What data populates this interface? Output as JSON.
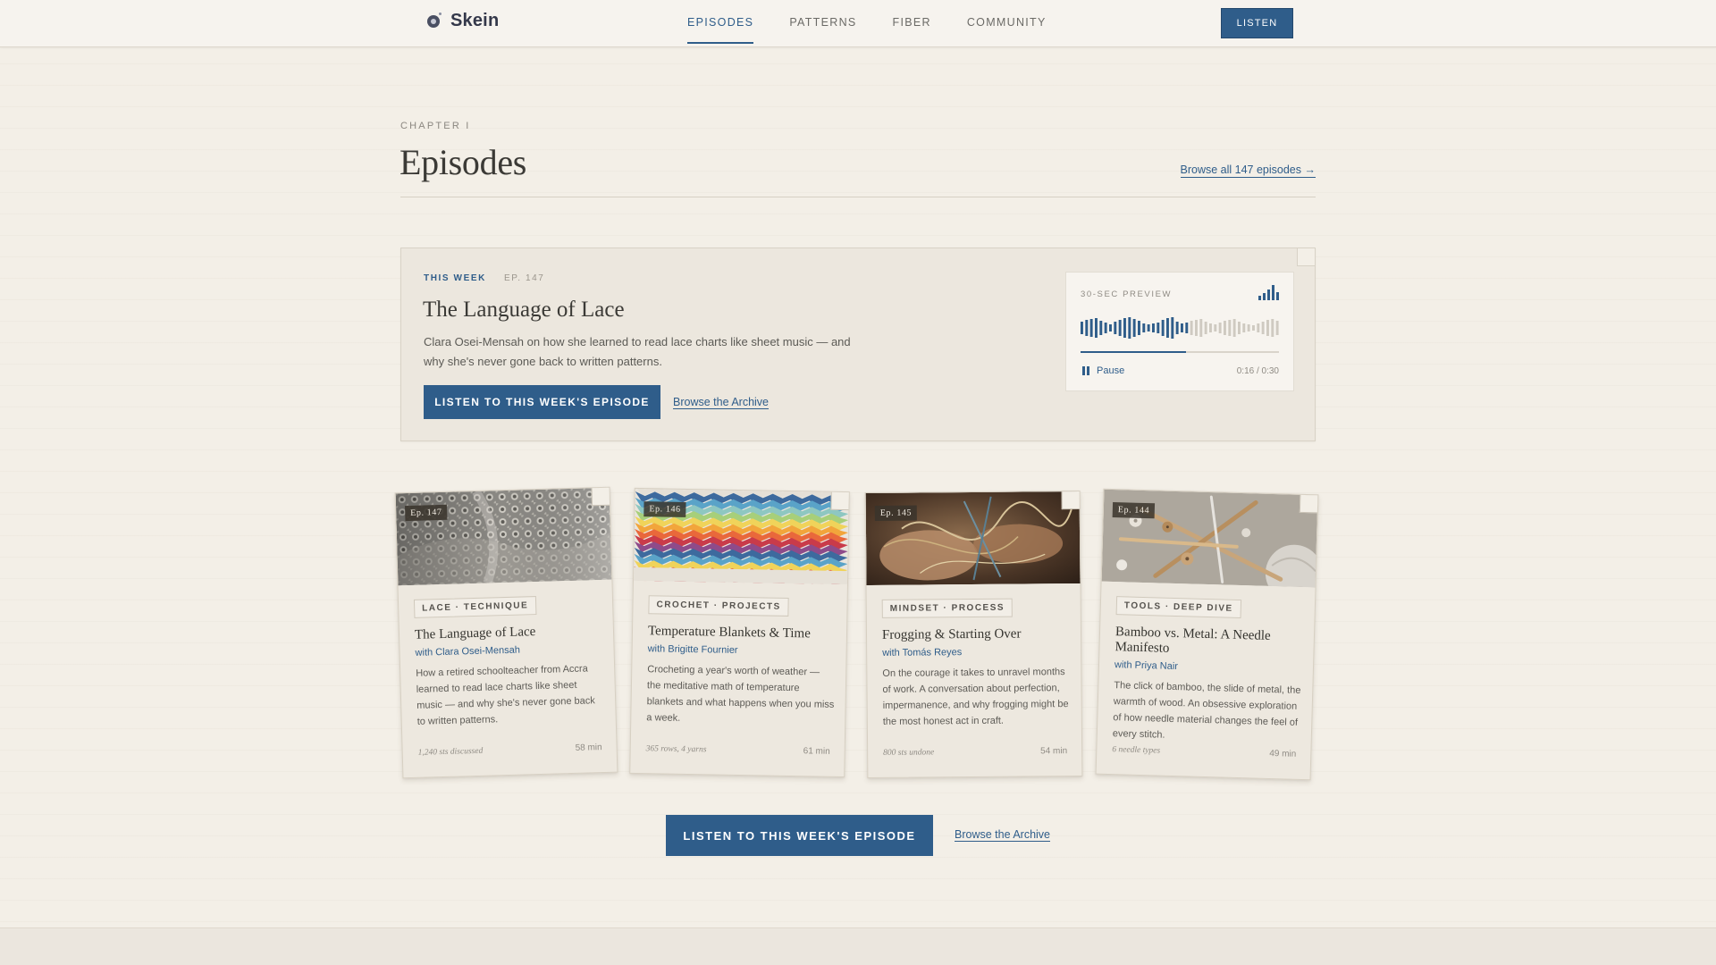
{
  "nav": {
    "brand": "Skein",
    "links": [
      {
        "label": "EPISODES",
        "active": true
      },
      {
        "label": "PATTERNS",
        "active": false
      },
      {
        "label": "FIBER",
        "active": false
      },
      {
        "label": "COMMUNITY",
        "active": false
      }
    ],
    "cta": "LISTEN",
    "icon": "skein-logo-icon"
  },
  "header": {
    "eyebrow": "CHAPTER I",
    "title": "Episodes",
    "browse_all": "Browse all 147 episodes →"
  },
  "featured": {
    "tag": "THIS WEEK",
    "episode": "EP. 147",
    "title": "The Language of Lace",
    "description": "Clara Osei-Mensah on how she learned to read lace charts like sheet music — and why she's never gone back to written patterns.",
    "button": "LISTEN TO THIS WEEK'S EPISODE",
    "link": "Browse the Archive",
    "player": {
      "label": "30-SEC PREVIEW",
      "pause": "Pause",
      "time": "0:16 / 0:30",
      "progress": 0.533,
      "icon": "bars-chart-icon"
    }
  },
  "cards": [
    {
      "ep": "Ep. 147",
      "tag": "LACE · TECHNIQUE",
      "title": "The Language of Lace",
      "host": "with Clara Osei-Mensah",
      "description": "How a retired schoolteacher from Accra learned to read lace charts like sheet music — and why she's never gone back to written patterns.",
      "stat": "1,240 sts discussed",
      "duration": "58 min",
      "image": "lace-knitting"
    },
    {
      "ep": "Ep. 146",
      "tag": "CROCHET · PROJECTS",
      "title": "Temperature Blankets & Time",
      "host": "with Brigitte Fournier",
      "description": "Crocheting a year's worth of weather — the meditative math of temperature blankets and what happens when you miss a week.",
      "stat": "365 rows, 4 yarns",
      "duration": "61 min",
      "image": "rainbow-chevron-blanket"
    },
    {
      "ep": "Ep. 145",
      "tag": "MINDSET · PROCESS",
      "title": "Frogging & Starting Over",
      "host": "with Tomás Reyes",
      "description": "On the courage it takes to unravel months of work. A conversation about perfection, impermanence, and why frogging might be the most honest act in craft.",
      "stat": "800 sts undone",
      "duration": "54 min",
      "image": "hands-unraveling-yarn"
    },
    {
      "ep": "Ep. 144",
      "tag": "TOOLS · DEEP DIVE",
      "title": "Bamboo vs. Metal: A Needle Manifesto",
      "host": "with Priya Nair",
      "description": "The click of bamboo, the slide of metal, the warmth of wood. An obsessive exploration of how needle material changes the feel of every stitch.",
      "stat": "6 needle types",
      "duration": "49 min",
      "image": "knitting-needles-and-buttons"
    }
  ],
  "cta": {
    "button": "LISTEN TO THIS WEEK'S EPISODE",
    "link": "Browse the Archive"
  }
}
